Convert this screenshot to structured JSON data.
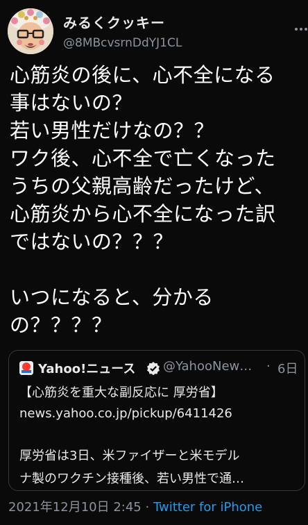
{
  "author": {
    "display_name": "みるくクッキー",
    "handle": "@8MBcvsrnDdYJ1CL"
  },
  "tweet": {
    "text": "心筋炎の後に、心不全になる\n事はないの？\n若い男性だけなの？？\nワク後、心不全で亡くなった\nうちの父親高齢だったけど、\n心筋炎から心不全になった訳\nではないの？？？\n\nいつになると、分かる\nの？？？？"
  },
  "quoted": {
    "source_name": "Yahoo!ニュース",
    "handle": "@YahooNew…",
    "separator": "·",
    "date": "6日",
    "headline": "【心筋炎を重大な副反応に 厚労省】",
    "link": "news.yahoo.co.jp/pickup/6411426",
    "body_line1": "厚労省は3日、米ファイザーと米モデル",
    "body_line2": "ナ製のワクチン接種後、若い男性で通…"
  },
  "meta": {
    "timestamp": "2021年12月10日 2:45",
    "separator": "·",
    "source": "Twitter for iPhone"
  },
  "colors": {
    "background": "#0a0a0a",
    "text": "#ffffff",
    "secondary": "#8b949e",
    "link": "#1d9bf0"
  }
}
